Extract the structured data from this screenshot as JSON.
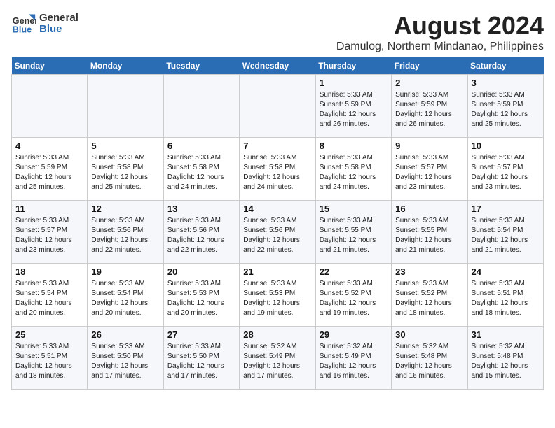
{
  "header": {
    "logo_line1": "General",
    "logo_line2": "Blue",
    "month_year": "August 2024",
    "location": "Damulog, Northern Mindanao, Philippines"
  },
  "weekdays": [
    "Sunday",
    "Monday",
    "Tuesday",
    "Wednesday",
    "Thursday",
    "Friday",
    "Saturday"
  ],
  "weeks": [
    [
      {
        "day": "",
        "info": ""
      },
      {
        "day": "",
        "info": ""
      },
      {
        "day": "",
        "info": ""
      },
      {
        "day": "",
        "info": ""
      },
      {
        "day": "1",
        "info": "Sunrise: 5:33 AM\nSunset: 5:59 PM\nDaylight: 12 hours\nand 26 minutes."
      },
      {
        "day": "2",
        "info": "Sunrise: 5:33 AM\nSunset: 5:59 PM\nDaylight: 12 hours\nand 26 minutes."
      },
      {
        "day": "3",
        "info": "Sunrise: 5:33 AM\nSunset: 5:59 PM\nDaylight: 12 hours\nand 25 minutes."
      }
    ],
    [
      {
        "day": "4",
        "info": "Sunrise: 5:33 AM\nSunset: 5:59 PM\nDaylight: 12 hours\nand 25 minutes."
      },
      {
        "day": "5",
        "info": "Sunrise: 5:33 AM\nSunset: 5:58 PM\nDaylight: 12 hours\nand 25 minutes."
      },
      {
        "day": "6",
        "info": "Sunrise: 5:33 AM\nSunset: 5:58 PM\nDaylight: 12 hours\nand 24 minutes."
      },
      {
        "day": "7",
        "info": "Sunrise: 5:33 AM\nSunset: 5:58 PM\nDaylight: 12 hours\nand 24 minutes."
      },
      {
        "day": "8",
        "info": "Sunrise: 5:33 AM\nSunset: 5:58 PM\nDaylight: 12 hours\nand 24 minutes."
      },
      {
        "day": "9",
        "info": "Sunrise: 5:33 AM\nSunset: 5:57 PM\nDaylight: 12 hours\nand 23 minutes."
      },
      {
        "day": "10",
        "info": "Sunrise: 5:33 AM\nSunset: 5:57 PM\nDaylight: 12 hours\nand 23 minutes."
      }
    ],
    [
      {
        "day": "11",
        "info": "Sunrise: 5:33 AM\nSunset: 5:57 PM\nDaylight: 12 hours\nand 23 minutes."
      },
      {
        "day": "12",
        "info": "Sunrise: 5:33 AM\nSunset: 5:56 PM\nDaylight: 12 hours\nand 22 minutes."
      },
      {
        "day": "13",
        "info": "Sunrise: 5:33 AM\nSunset: 5:56 PM\nDaylight: 12 hours\nand 22 minutes."
      },
      {
        "day": "14",
        "info": "Sunrise: 5:33 AM\nSunset: 5:56 PM\nDaylight: 12 hours\nand 22 minutes."
      },
      {
        "day": "15",
        "info": "Sunrise: 5:33 AM\nSunset: 5:55 PM\nDaylight: 12 hours\nand 21 minutes."
      },
      {
        "day": "16",
        "info": "Sunrise: 5:33 AM\nSunset: 5:55 PM\nDaylight: 12 hours\nand 21 minutes."
      },
      {
        "day": "17",
        "info": "Sunrise: 5:33 AM\nSunset: 5:54 PM\nDaylight: 12 hours\nand 21 minutes."
      }
    ],
    [
      {
        "day": "18",
        "info": "Sunrise: 5:33 AM\nSunset: 5:54 PM\nDaylight: 12 hours\nand 20 minutes."
      },
      {
        "day": "19",
        "info": "Sunrise: 5:33 AM\nSunset: 5:54 PM\nDaylight: 12 hours\nand 20 minutes."
      },
      {
        "day": "20",
        "info": "Sunrise: 5:33 AM\nSunset: 5:53 PM\nDaylight: 12 hours\nand 20 minutes."
      },
      {
        "day": "21",
        "info": "Sunrise: 5:33 AM\nSunset: 5:53 PM\nDaylight: 12 hours\nand 19 minutes."
      },
      {
        "day": "22",
        "info": "Sunrise: 5:33 AM\nSunset: 5:52 PM\nDaylight: 12 hours\nand 19 minutes."
      },
      {
        "day": "23",
        "info": "Sunrise: 5:33 AM\nSunset: 5:52 PM\nDaylight: 12 hours\nand 18 minutes."
      },
      {
        "day": "24",
        "info": "Sunrise: 5:33 AM\nSunset: 5:51 PM\nDaylight: 12 hours\nand 18 minutes."
      }
    ],
    [
      {
        "day": "25",
        "info": "Sunrise: 5:33 AM\nSunset: 5:51 PM\nDaylight: 12 hours\nand 18 minutes."
      },
      {
        "day": "26",
        "info": "Sunrise: 5:33 AM\nSunset: 5:50 PM\nDaylight: 12 hours\nand 17 minutes."
      },
      {
        "day": "27",
        "info": "Sunrise: 5:33 AM\nSunset: 5:50 PM\nDaylight: 12 hours\nand 17 minutes."
      },
      {
        "day": "28",
        "info": "Sunrise: 5:32 AM\nSunset: 5:49 PM\nDaylight: 12 hours\nand 17 minutes."
      },
      {
        "day": "29",
        "info": "Sunrise: 5:32 AM\nSunset: 5:49 PM\nDaylight: 12 hours\nand 16 minutes."
      },
      {
        "day": "30",
        "info": "Sunrise: 5:32 AM\nSunset: 5:48 PM\nDaylight: 12 hours\nand 16 minutes."
      },
      {
        "day": "31",
        "info": "Sunrise: 5:32 AM\nSunset: 5:48 PM\nDaylight: 12 hours\nand 15 minutes."
      }
    ]
  ]
}
